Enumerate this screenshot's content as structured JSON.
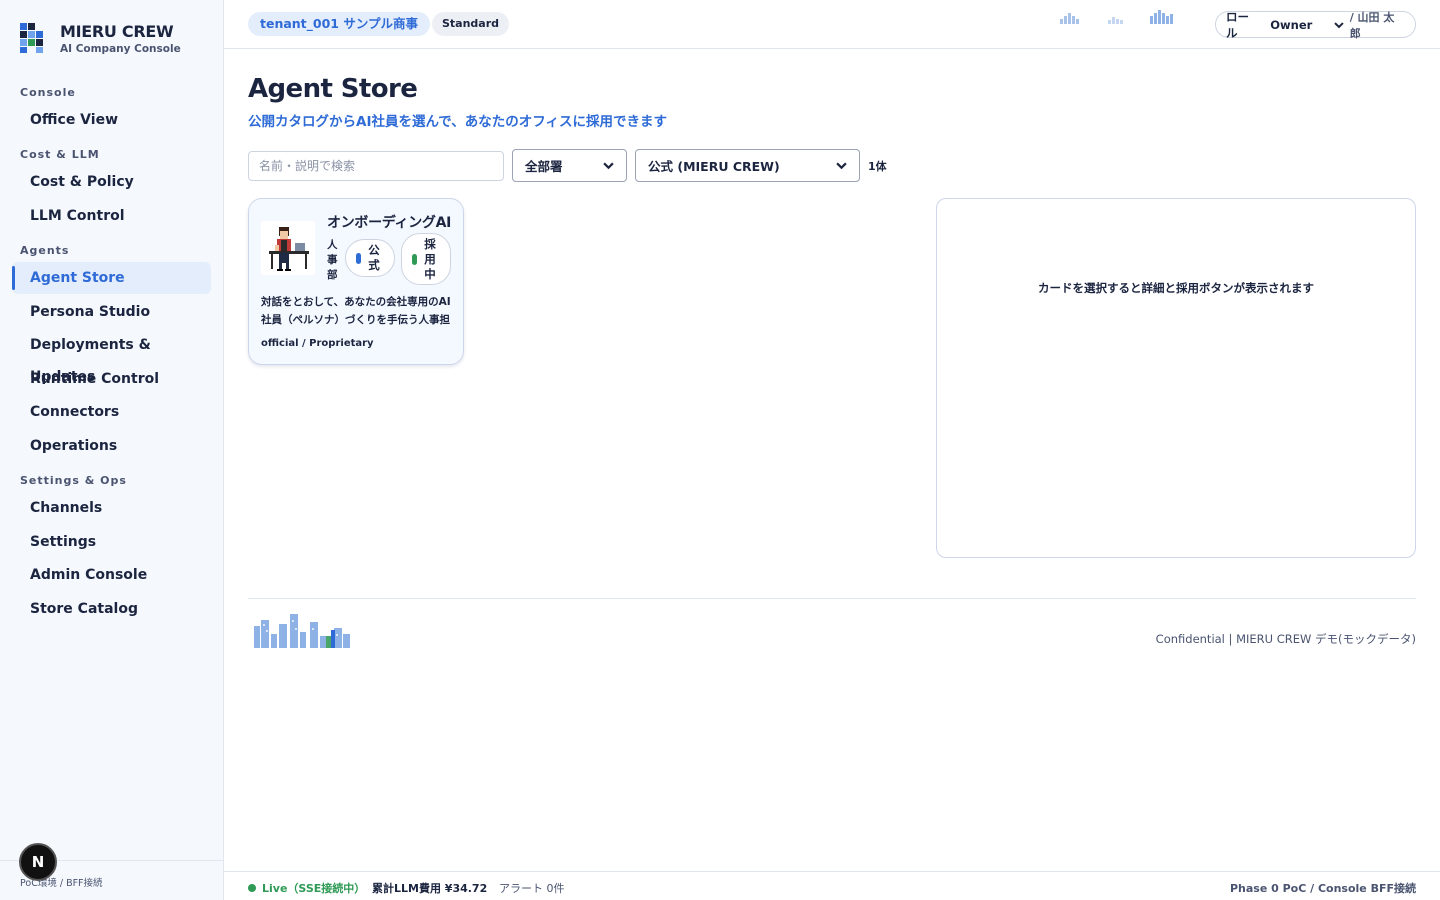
{
  "brand": {
    "name": "MIERU CREW",
    "subtitle": "AI Company Console"
  },
  "sidebar": {
    "sections": [
      {
        "title": "Console",
        "items": [
          {
            "label": "Office View"
          }
        ]
      },
      {
        "title": "Cost & LLM",
        "items": [
          {
            "label": "Cost & Policy"
          },
          {
            "label": "LLM Control"
          }
        ]
      },
      {
        "title": "Agents",
        "items": [
          {
            "label": "Agent Store",
            "active": true
          },
          {
            "label": "Persona Studio"
          },
          {
            "label": "Deployments & Updates"
          },
          {
            "label": "Runtime Control"
          },
          {
            "label": "Connectors"
          },
          {
            "label": "Operations"
          }
        ]
      },
      {
        "title": "Settings & Ops",
        "items": [
          {
            "label": "Channels"
          },
          {
            "label": "Settings"
          },
          {
            "label": "Admin Console"
          },
          {
            "label": "Store Catalog"
          }
        ]
      }
    ],
    "footer": "PoC環境 / BFF接続",
    "badge": "N"
  },
  "header": {
    "tenant": "tenant_001 サンプル商事",
    "plan": "Standard",
    "role_label": "ロール",
    "role_value": "Owner",
    "user": "/ 山田 太郎"
  },
  "page": {
    "title": "Agent Store",
    "subtitle": "公開カタログからAI社員を選んで、あなたのオフィスに採用できます",
    "search_placeholder": "名前・説明で検索",
    "department_filter": "全部署",
    "source_filter": "公式 (MIERU CREW)",
    "count": "1体"
  },
  "cards": [
    {
      "title": "オンボーディングAI",
      "department": "人事部",
      "badge_official": "公式",
      "badge_status": "採用中",
      "description": "対話をとおして、あなたの会社専用のAI社員（ペルソナ）づくりを手伝う人事担当のAI社員です。",
      "license": "official / Proprietary"
    }
  ],
  "detail": {
    "placeholder": "カードを選択すると詳細と採用ボタンが表示されます"
  },
  "footer": {
    "confidential": "Confidential | MIERU CREW デモ(モックデータ)"
  },
  "statusbar": {
    "live": "Live（SSE接続中）",
    "cost": "累計LLM費用 ¥34.72",
    "alerts": "アラート 0件",
    "phase": "Phase 0 PoC / Console BFF接続"
  },
  "colors": {
    "accent": "#2f6bd6",
    "live": "#2e9a55",
    "official_dot": "#2f6bd6",
    "status_dot": "#2e9a55"
  }
}
